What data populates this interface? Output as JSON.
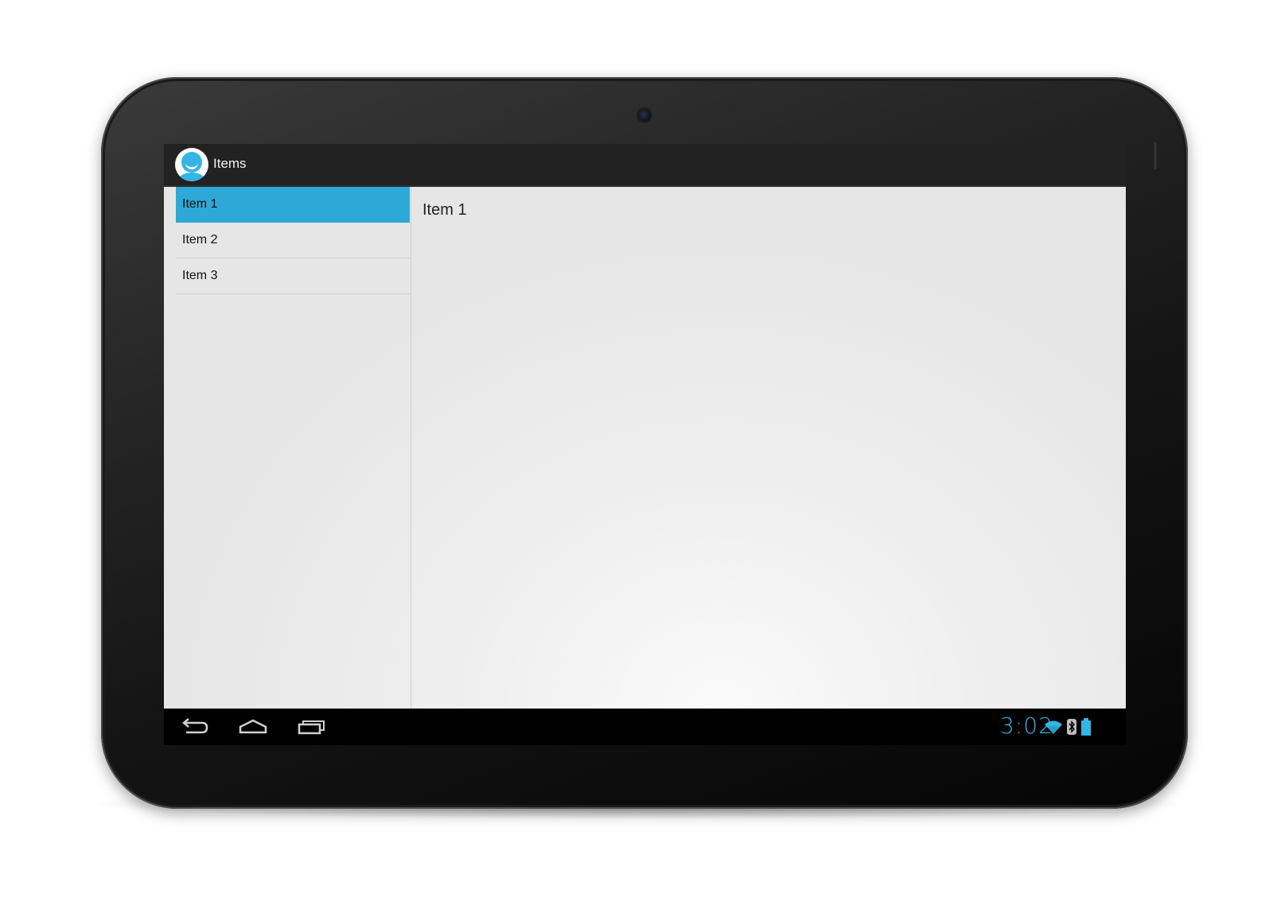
{
  "action_bar": {
    "title": "Items",
    "app_icon": "smiley-person-icon"
  },
  "list": {
    "items": [
      {
        "label": "Item 1",
        "selected": true
      },
      {
        "label": "Item 2",
        "selected": false
      },
      {
        "label": "Item 3",
        "selected": false
      }
    ]
  },
  "detail": {
    "title": "Item 1"
  },
  "nav_bar": {
    "buttons": [
      "back-icon",
      "home-icon",
      "recent-apps-icon"
    ],
    "clock": "3:02",
    "status_icons": [
      "wifi-icon",
      "bluetooth-icon",
      "battery-icon"
    ]
  },
  "colors": {
    "accent": "#33b5e5",
    "selection": "#2ea8d6",
    "action_bar": "#222222",
    "nav_bar": "#000000"
  }
}
